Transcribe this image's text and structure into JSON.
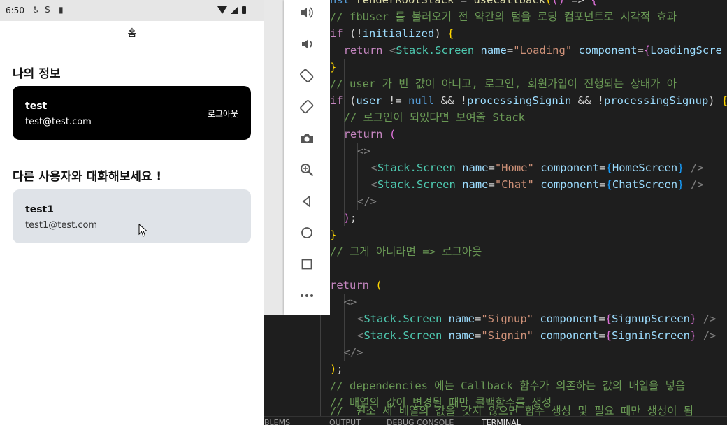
{
  "status_bar": {
    "time": "6:50",
    "icons": [
      "accessibility-icon",
      "sync-icon",
      "sd-card-icon",
      "wifi-icon",
      "signal-icon",
      "battery-icon"
    ]
  },
  "app": {
    "header_title": "홈",
    "my_info_title": "나의 정보",
    "me": {
      "name": "test",
      "email": "test@test.com",
      "logout_label": "로그아웃"
    },
    "chat_title": "다른 사용자와 대화해보세요 !",
    "users": [
      {
        "name": "test1",
        "email": "test1@test.com"
      }
    ]
  },
  "emulator_toolbar": [
    "volume-up-icon",
    "volume-down-icon",
    "rotate-left-icon",
    "rotate-right-icon",
    "camera-icon",
    "zoom-icon",
    "back-icon",
    "home-icon",
    "overview-icon",
    "more-icon"
  ],
  "editor": {
    "lines": [
      {
        "indent": 0,
        "tokens": [
          [
            "cmt",
            "// fbUser 를 불러오기 전 약간의 텀을 로딩 컴포넌트로 시각적 효과"
          ]
        ]
      },
      {
        "indent": 0,
        "tokens": [
          [
            "kw2",
            "if"
          ],
          [
            "pun",
            " ("
          ],
          [
            "pun",
            "!"
          ],
          [
            "var",
            "initialized"
          ],
          [
            "pun",
            ") "
          ],
          [
            "br1",
            "{"
          ]
        ]
      },
      {
        "indent": 1,
        "tokens": [
          [
            "kw2",
            "return"
          ],
          [
            "pun",
            " "
          ],
          [
            "gray",
            "<"
          ],
          [
            "tag",
            "Stack.Screen"
          ],
          [
            "pun",
            " "
          ],
          [
            "var",
            "name"
          ],
          [
            "pun",
            "="
          ],
          [
            "str",
            "\"Loading\""
          ],
          [
            "pun",
            " "
          ],
          [
            "var",
            "component"
          ],
          [
            "pun",
            "="
          ],
          [
            "br2",
            "{"
          ],
          [
            "var",
            "LoadingScre"
          ]
        ]
      },
      {
        "indent": 0,
        "tokens": [
          [
            "br1",
            "}"
          ]
        ]
      },
      {
        "indent": 0,
        "tokens": [
          [
            "cmt",
            "// user 가 빈 값이 아니고, 로그인, 회원가입이 진행되는 상태가 아"
          ]
        ]
      },
      {
        "indent": 0,
        "tokens": [
          [
            "kw2",
            "if"
          ],
          [
            "pun",
            " ("
          ],
          [
            "var",
            "user"
          ],
          [
            "pun",
            " != "
          ],
          [
            "kw",
            "null"
          ],
          [
            "pun",
            " && !"
          ],
          [
            "var",
            "processingSignin"
          ],
          [
            "pun",
            " && !"
          ],
          [
            "var",
            "processingSignup"
          ],
          [
            "pun",
            ") "
          ],
          [
            "br1",
            "{"
          ]
        ]
      },
      {
        "indent": 1,
        "tokens": [
          [
            "cmt",
            "// 로그인이 되었다면 보여줄 Stack"
          ]
        ]
      },
      {
        "indent": 1,
        "tokens": [
          [
            "kw2",
            "return"
          ],
          [
            "pun",
            " "
          ],
          [
            "br2",
            "("
          ]
        ]
      },
      {
        "indent": 2,
        "tokens": [
          [
            "gray",
            "<>"
          ]
        ]
      },
      {
        "indent": 3,
        "tokens": [
          [
            "gray",
            "<"
          ],
          [
            "tag",
            "Stack.Screen"
          ],
          [
            "pun",
            " "
          ],
          [
            "var",
            "name"
          ],
          [
            "pun",
            "="
          ],
          [
            "str",
            "\"Home\""
          ],
          [
            "pun",
            " "
          ],
          [
            "var",
            "component"
          ],
          [
            "pun",
            "="
          ],
          [
            "br3",
            "{"
          ],
          [
            "var",
            "HomeScreen"
          ],
          [
            "br3",
            "}"
          ],
          [
            "pun",
            " "
          ],
          [
            "gray",
            "/>"
          ]
        ]
      },
      {
        "indent": 3,
        "tokens": [
          [
            "gray",
            "<"
          ],
          [
            "tag",
            "Stack.Screen"
          ],
          [
            "pun",
            " "
          ],
          [
            "var",
            "name"
          ],
          [
            "pun",
            "="
          ],
          [
            "str",
            "\"Chat\""
          ],
          [
            "pun",
            " "
          ],
          [
            "var",
            "component"
          ],
          [
            "pun",
            "="
          ],
          [
            "br3",
            "{"
          ],
          [
            "var",
            "ChatScreen"
          ],
          [
            "br3",
            "}"
          ],
          [
            "pun",
            " "
          ],
          [
            "gray",
            "/>"
          ]
        ]
      },
      {
        "indent": 2,
        "tokens": [
          [
            "gray",
            "</>"
          ]
        ]
      },
      {
        "indent": 1,
        "tokens": [
          [
            "br2",
            ")"
          ],
          [
            "pun",
            ";"
          ]
        ]
      },
      {
        "indent": 0,
        "tokens": [
          [
            "br1",
            "}"
          ]
        ]
      },
      {
        "indent": 0,
        "tokens": [
          [
            "cmt",
            "// 그게 아니라면 => 로그아웃"
          ]
        ]
      },
      {
        "indent": 0,
        "tokens": []
      },
      {
        "indent": 0,
        "tokens": [
          [
            "kw2",
            "return"
          ],
          [
            "pun",
            " "
          ],
          [
            "br1",
            "("
          ]
        ]
      },
      {
        "indent": 1,
        "tokens": [
          [
            "gray",
            "<>"
          ]
        ]
      },
      {
        "indent": 2,
        "tokens": [
          [
            "gray",
            "<"
          ],
          [
            "tag",
            "Stack.Screen"
          ],
          [
            "pun",
            " "
          ],
          [
            "var",
            "name"
          ],
          [
            "pun",
            "="
          ],
          [
            "str",
            "\"Signup\""
          ],
          [
            "pun",
            " "
          ],
          [
            "var",
            "component"
          ],
          [
            "pun",
            "="
          ],
          [
            "br2",
            "{"
          ],
          [
            "var",
            "SignupScreen"
          ],
          [
            "br2",
            "}"
          ],
          [
            "pun",
            " "
          ],
          [
            "gray",
            "/>"
          ]
        ]
      },
      {
        "indent": 2,
        "tokens": [
          [
            "gray",
            "<"
          ],
          [
            "tag",
            "Stack.Screen"
          ],
          [
            "pun",
            " "
          ],
          [
            "var",
            "name"
          ],
          [
            "pun",
            "="
          ],
          [
            "str",
            "\"Signin\""
          ],
          [
            "pun",
            " "
          ],
          [
            "var",
            "component"
          ],
          [
            "pun",
            "="
          ],
          [
            "br2",
            "{"
          ],
          [
            "var",
            "SigninScreen"
          ],
          [
            "br2",
            "}"
          ],
          [
            "pun",
            " "
          ],
          [
            "gray",
            "/>"
          ]
        ]
      },
      {
        "indent": 1,
        "tokens": [
          [
            "gray",
            "</>"
          ]
        ]
      },
      {
        "indent": 0,
        "tokens": [
          [
            "br1",
            ")"
          ],
          [
            "pun",
            ";"
          ]
        ]
      },
      {
        "indent": 0,
        "tokens": [
          [
            "cmt",
            "// dependencies 에는 Callback 함수가 의존하는 값의 배열을 넣음"
          ]
        ]
      },
      {
        "indent": 0,
        "tokens": [
          [
            "cmt",
            "// 배열의 값이 변경될 때만 콜백함수를 생성"
          ]
        ]
      }
    ]
  },
  "panel_tabs": [
    {
      "label": "BLEMS",
      "active": false
    },
    {
      "label": "OUTPUT",
      "active": false
    },
    {
      "label": "DEBUG CONSOLE",
      "active": false
    },
    {
      "label": "TERMINAL",
      "active": true
    }
  ]
}
